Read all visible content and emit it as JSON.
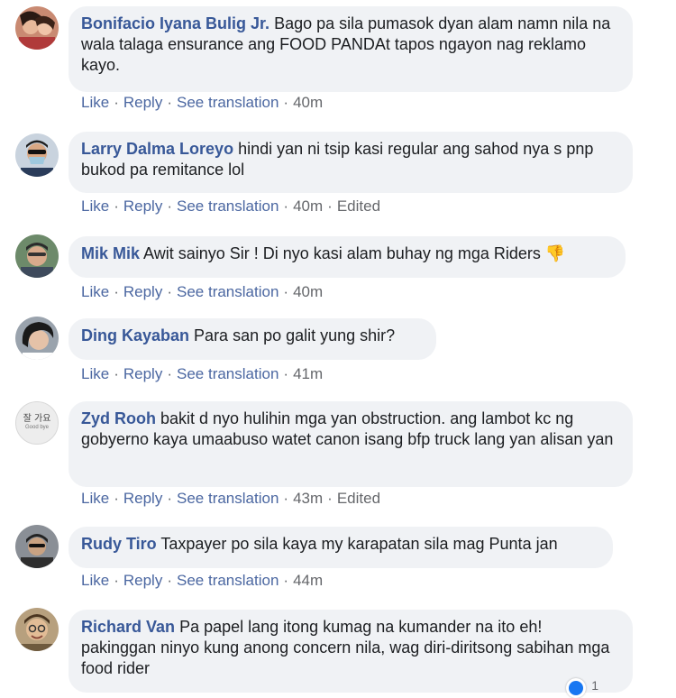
{
  "actions": {
    "like": "Like",
    "reply": "Reply",
    "see_translation": "See translation",
    "edited": "Edited",
    "separator": "·"
  },
  "comments": [
    {
      "author": "Bonifacio Iyana Bulig Jr.",
      "text": "Bago pa sila pumasok dyan alam namn nila na wala talaga ensurance ang FOOD PANDAt tapos ngayon nag reklamo kayo.",
      "time": "40m",
      "edited": false
    },
    {
      "author": "Larry Dalma Loreyo",
      "text": "hindi yan ni tsip kasi regular ang sahod nya s pnp bukod pa remitance lol",
      "time": "40m",
      "edited": true
    },
    {
      "author": "Mik Mik",
      "text": "Awit sainyo Sir ! Di nyo kasi alam buhay ng mga Riders",
      "emoji": "👎",
      "time": "40m",
      "edited": false
    },
    {
      "author": "Ding Kayaban",
      "text": "Para san po galit yung shir?",
      "time": "41m",
      "edited": false
    },
    {
      "author": "Zyd Rooh",
      "text": "bakit d nyo hulihin mga yan obstruction. ang lambot kc ng gobyerno kaya umaabuso watet canon isang bfp truck lang yan alisan yan",
      "time": "43m",
      "edited": true,
      "avatar_text": "잘 가요",
      "avatar_subtext": "Good bye"
    },
    {
      "author": "Rudy Tiro",
      "text": "Taxpayer po sila kaya my karapatan sila mag Punta jan",
      "time": "44m",
      "edited": false
    },
    {
      "author": "Richard Van",
      "text": "Pa papel lang itong kumag na kumander na ito eh! pakinggan ninyo kung anong concern nila, wag diri-diritsong sabihan mga food rider",
      "reaction_count": "1"
    }
  ]
}
